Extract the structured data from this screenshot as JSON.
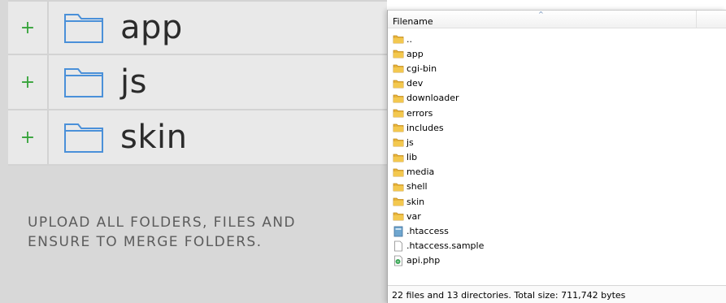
{
  "folders": [
    {
      "plus": "+",
      "name": "app"
    },
    {
      "plus": "+",
      "name": "js"
    },
    {
      "plus": "+",
      "name": "skin"
    }
  ],
  "instructions": {
    "line1": "UPLOAD ALL FOLDERS, FILES AND",
    "line2": "ENSURE TO MERGE FOLDERS."
  },
  "file_window": {
    "column_header": "Filename",
    "sort_indicator": "^",
    "entries": [
      {
        "name": "..",
        "icon": "folder-icon"
      },
      {
        "name": "app",
        "icon": "folder-icon"
      },
      {
        "name": "cgi-bin",
        "icon": "folder-icon"
      },
      {
        "name": "dev",
        "icon": "folder-icon"
      },
      {
        "name": "downloader",
        "icon": "folder-icon"
      },
      {
        "name": "errors",
        "icon": "folder-icon"
      },
      {
        "name": "includes",
        "icon": "folder-icon"
      },
      {
        "name": "js",
        "icon": "folder-icon"
      },
      {
        "name": "lib",
        "icon": "folder-icon"
      },
      {
        "name": "media",
        "icon": "folder-icon"
      },
      {
        "name": "shell",
        "icon": "folder-icon"
      },
      {
        "name": "skin",
        "icon": "folder-icon"
      },
      {
        "name": "var",
        "icon": "folder-icon"
      },
      {
        "name": ".htaccess",
        "icon": "htaccess-file-icon"
      },
      {
        "name": ".htaccess.sample",
        "icon": "blank-file-icon"
      },
      {
        "name": "api.php",
        "icon": "php-file-icon"
      }
    ],
    "status": "22 files and 13 directories. Total size: 711,742 bytes"
  },
  "colors": {
    "plus": "#36a33a",
    "folder_outline": "#4a90d9",
    "folder_yellow": "#e8b43a",
    "panel_bg": "#d8d8d8",
    "row_bg": "#e9e9e9"
  }
}
